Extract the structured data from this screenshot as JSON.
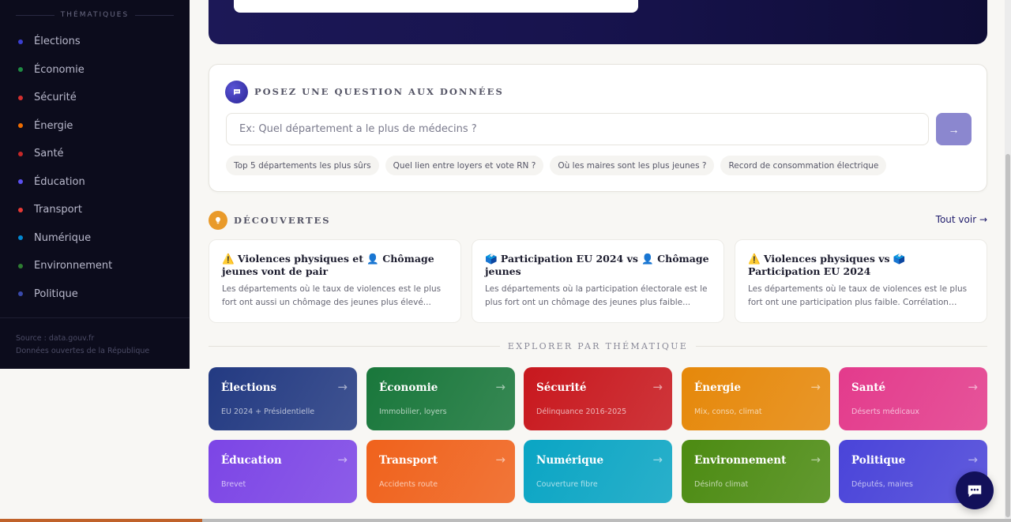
{
  "sidebar": {
    "heading": "THÉMATIQUES",
    "items": [
      {
        "label": "Élections",
        "color": "#3b3fd1"
      },
      {
        "label": "Économie",
        "color": "#1e8a43"
      },
      {
        "label": "Sécurité",
        "color": "#d32f2f"
      },
      {
        "label": "Énergie",
        "color": "#ef6c00"
      },
      {
        "label": "Santé",
        "color": "#c62828"
      },
      {
        "label": "Éducation",
        "color": "#5b50f0"
      },
      {
        "label": "Transport",
        "color": "#e53935"
      },
      {
        "label": "Numérique",
        "color": "#0288d1"
      },
      {
        "label": "Environnement",
        "color": "#2e7d32"
      },
      {
        "label": "Politique",
        "color": "#3949ab"
      }
    ],
    "source_line": "Source : data.gouv.fr",
    "source_sub": "Données ouvertes de la République"
  },
  "ask": {
    "title": "POSEZ UNE QUESTION AUX DONNÉES",
    "placeholder": "Ex: Quel département a le plus de médecins ?",
    "submit_icon": "→",
    "chips": [
      "Top 5 départements les plus sûrs",
      "Quel lien entre loyers et vote RN ?",
      "Où les maires sont les plus jeunes ?",
      "Record de consommation électrique"
    ]
  },
  "discoveries": {
    "title": "DÉCOUVERTES",
    "see_all": "Tout voir →",
    "cards": [
      {
        "title": "⚠️ Violences physiques et 👤 Chômage jeunes vont de pair",
        "desc": "Les départements où le taux de violences est le plus fort ont aussi un chômage des jeunes plus élevé..."
      },
      {
        "title": "🗳️ Participation EU 2024 vs 👤 Chômage jeunes",
        "desc": "Les départements où la participation électorale est le plus fort ont un chômage des jeunes plus faible..."
      },
      {
        "title": "⚠️ Violences physiques vs 🗳️ Participation EU 2024",
        "desc": "Les départements où le taux de violences est le plus fort ont une participation plus faible. Corrélation inverse..."
      }
    ]
  },
  "explore": {
    "title": "EXPLORER PAR THÉMATIQUE",
    "arrow": "→",
    "tiles": [
      {
        "name": "Élections",
        "sub": "EU 2024 + Présidentielle",
        "color": "#233a82"
      },
      {
        "name": "Économie",
        "sub": "Immobilier, loyers",
        "color": "#19773b"
      },
      {
        "name": "Sécurité",
        "sub": "Délinquance 2016-2025",
        "color": "#c8181e"
      },
      {
        "name": "Énergie",
        "sub": "Mix, conso, climat",
        "color": "#e6880a"
      },
      {
        "name": "Santé",
        "sub": "Déserts médicaux",
        "color": "#e33b8c"
      },
      {
        "name": "Éducation",
        "sub": "Brevet",
        "color": "#7c45e6"
      },
      {
        "name": "Transport",
        "sub": "Accidents route",
        "color": "#f0621c"
      },
      {
        "name": "Numérique",
        "sub": "Couverture fibre",
        "color": "#0aa5c4"
      },
      {
        "name": "Environnement",
        "sub": "Désinfo climat",
        "color": "#4c8b12"
      },
      {
        "name": "Politique",
        "sub": "Députés, maires",
        "color": "#4a44d9"
      }
    ]
  },
  "progress": 0.2
}
